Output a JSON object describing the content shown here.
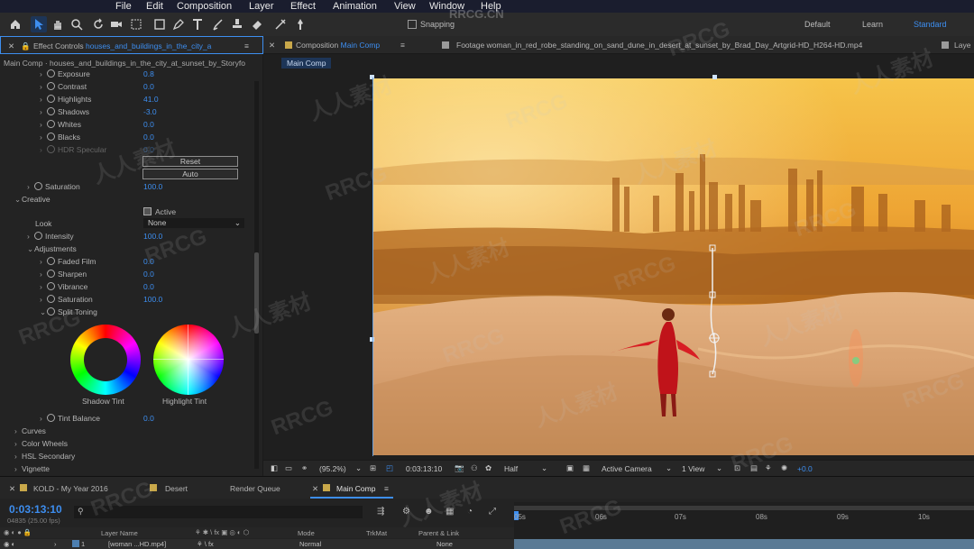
{
  "menu": {
    "file": "File",
    "edit": "Edit",
    "composition": "Composition",
    "layer": "Layer",
    "effect": "Effect",
    "animation": "Animation",
    "view": "View",
    "window": "Window",
    "help": "Help"
  },
  "toolbar": {
    "snapping_label": "Snapping",
    "workspaces": [
      "Default",
      "Learn",
      "Standard"
    ]
  },
  "effect_panel": {
    "tab_prefix": "Effect Controls",
    "tab_layer": "houses_and_buildings_in_the_city_a",
    "breadcrumb": "Main Comp · houses_and_buildings_in_the_city_at_sunset_by_Storyfo",
    "props": [
      {
        "label": "Exposure",
        "value": "0.8"
      },
      {
        "label": "Contrast",
        "value": "0.0"
      },
      {
        "label": "Highlights",
        "value": "41.0"
      },
      {
        "label": "Shadows",
        "value": "-3.0"
      },
      {
        "label": "Whites",
        "value": "0.0"
      },
      {
        "label": "Blacks",
        "value": "0.0"
      },
      {
        "label": "HDR Specular",
        "value": "0.0"
      }
    ],
    "reset_label": "Reset",
    "auto_label": "Auto",
    "saturation_label": "Saturation",
    "saturation_value": "100.0",
    "creative_label": "Creative",
    "active_label": "Active",
    "look_label": "Look",
    "look_value": "None",
    "intensity_label": "Intensity",
    "intensity_value": "100.0",
    "adjustments_label": "Adjustments",
    "adjust_props": [
      {
        "label": "Faded Film",
        "value": "0.0"
      },
      {
        "label": "Sharpen",
        "value": "0.0"
      },
      {
        "label": "Vibrance",
        "value": "0.0"
      },
      {
        "label": "Saturation",
        "value": "100.0"
      }
    ],
    "split_toning_label": "Split Toning",
    "shadow_tint_label": "Shadow Tint",
    "highlight_tint_label": "Highlight Tint",
    "tint_balance_label": "Tint Balance",
    "tint_balance_value": "0.0",
    "sections": [
      "Curves",
      "Color Wheels",
      "HSL Secondary",
      "Vignette"
    ]
  },
  "comp_panel": {
    "tab_prefix": "Composition",
    "tab_name": "Main Comp",
    "footage_tab": "Footage woman_in_red_robe_standing_on_sand_dune_in_desert_at_sunset_by_Brad_Day_Artgrid-HD_H264-HD.mp4",
    "layer_tab_partial": "Laye",
    "subtab": "Main Comp",
    "zoom": "(95.2%)",
    "timecode": "0:03:13:10",
    "resolution": "Half",
    "camera": "Active Camera",
    "view": "1 View",
    "exposure": "+0.0"
  },
  "timeline": {
    "tabs": [
      "KOLD - My Year 2016",
      "Desert",
      "Render Queue",
      "Main Comp"
    ],
    "timecode": "0:03:13:10",
    "frame_info": "04835 (25.00 fps)",
    "columns": {
      "layer_name": "Layer Name",
      "mode": "Mode",
      "trkmat": "TrkMat",
      "parent": "Parent & Link"
    },
    "ruler": [
      "05s",
      "06s",
      "07s",
      "08s",
      "09s",
      "10s"
    ],
    "row": {
      "num": "1",
      "name": "[woman ...HD.mp4]",
      "mode": "Normal",
      "parent": "None"
    }
  },
  "watermarks": [
    "RRCG",
    "人人素材",
    "RRCG.CN"
  ]
}
